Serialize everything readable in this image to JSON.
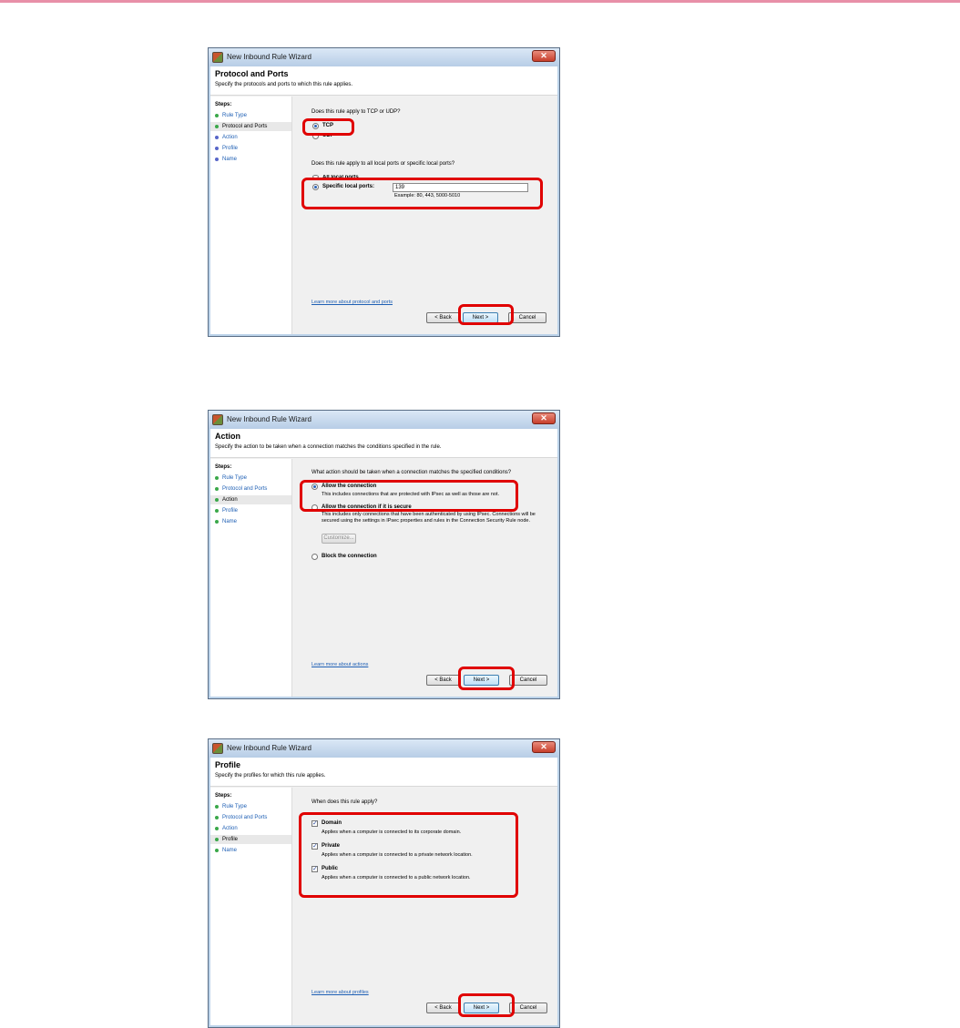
{
  "accent_highlight": "#e00000",
  "windows": [
    {
      "title": "New Inbound Rule Wizard",
      "header_title": "Protocol and Ports",
      "header_subtitle": "Specify the protocols and ports to which this rule applies.",
      "steps_title": "Steps:",
      "steps": [
        "Rule Type",
        "Protocol and Ports",
        "Action",
        "Profile",
        "Name"
      ],
      "question1": "Does this rule apply to TCP or UDP?",
      "tcp_label": "TCP",
      "udp_label": "UDP",
      "question2": "Does this rule apply to all local ports or specific local ports?",
      "all_ports_label": "All local ports",
      "specific_ports_label": "Specific local ports:",
      "ports_value": "139",
      "ports_example": "Example: 80, 443, 5000-5010",
      "link": "Learn more about protocol and ports",
      "back": "< Back",
      "next": "Next >",
      "cancel": "Cancel"
    },
    {
      "title": "New Inbound Rule Wizard",
      "header_title": "Action",
      "header_subtitle": "Specify the action to be taken when a connection matches the conditions specified in the rule.",
      "steps_title": "Steps:",
      "steps": [
        "Rule Type",
        "Protocol and Ports",
        "Action",
        "Profile",
        "Name"
      ],
      "question": "What action should be taken when a connection matches the specified conditions?",
      "allow_label": "Allow the connection",
      "allow_desc": "This includes connections that are protected with IPsec as well as those are not.",
      "secure_label": "Allow the connection if it is secure",
      "secure_desc": "This includes only connections that have been authenticated by using IPsec.  Connections will be secured using the settings in IPsec properties and rules in the Connection Security Rule node.",
      "customize": "Customize...",
      "block_label": "Block the connection",
      "link": "Learn more about actions",
      "back": "< Back",
      "next": "Next >",
      "cancel": "Cancel"
    },
    {
      "title": "New Inbound Rule Wizard",
      "header_title": "Profile",
      "header_subtitle": "Specify the profiles for which this rule applies.",
      "steps_title": "Steps:",
      "steps": [
        "Rule Type",
        "Protocol and Ports",
        "Action",
        "Profile",
        "Name"
      ],
      "question": "When does this rule apply?",
      "domain_label": "Domain",
      "domain_desc": "Applies when a computer is connected to its corporate domain.",
      "private_label": "Private",
      "private_desc": "Applies when a computer is connected to a private network location.",
      "public_label": "Public",
      "public_desc": "Applies when a computer is connected to a public network location.",
      "link": "Learn more about profiles",
      "back": "< Back",
      "next": "Next >",
      "cancel": "Cancel"
    }
  ]
}
